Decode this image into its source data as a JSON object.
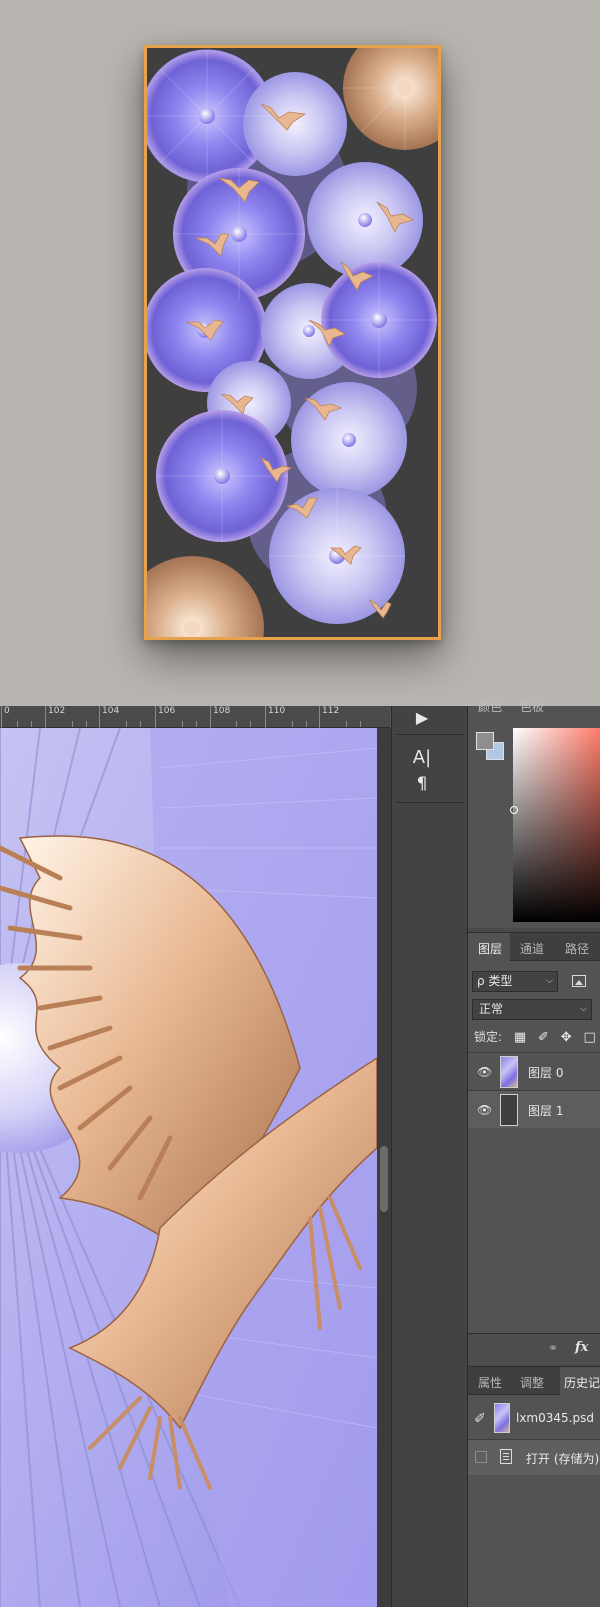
{
  "preview": {
    "frame_color": "#e8a24c",
    "artwork": "purple pleated umbrellas with golden birds"
  },
  "ruler": {
    "ticks": [
      "0",
      "102",
      "104",
      "106",
      "108",
      "110",
      "112"
    ]
  },
  "canvas": {
    "content": "zoomed umbrella and golden bird wing"
  },
  "tools": {
    "play": "▶",
    "character": "A|",
    "paragraph": "¶"
  },
  "color_panel": {
    "tabs": [
      "颜色",
      "色板"
    ],
    "foreground": "#8e8e8e",
    "background": "#b0c8e4"
  },
  "layers_panel": {
    "tabs": [
      "图层",
      "通道",
      "路径"
    ],
    "filter_label": "ρ 类型",
    "blend_mode": "正常",
    "lock_label": "锁定:",
    "layers": [
      {
        "name": "图层 0",
        "thumb": "art"
      },
      {
        "name": "图层 1",
        "thumb": "dark"
      }
    ],
    "fx_label": "fx"
  },
  "history_panel": {
    "tabs": [
      "属性",
      "调整",
      "历史记录"
    ],
    "snapshot_name": "lxm0345.psd",
    "step_label": "打开 (存储为)"
  }
}
